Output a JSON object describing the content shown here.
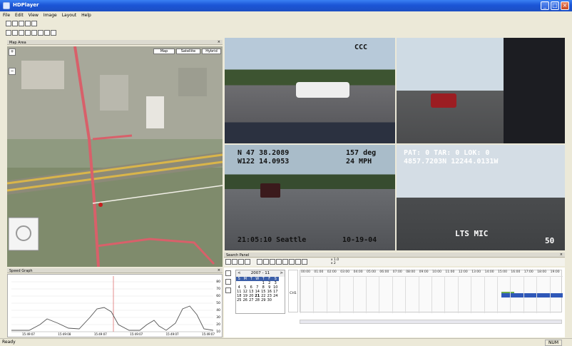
{
  "window": {
    "title": "HDPlayer",
    "min": "_",
    "max": "□",
    "close": "×"
  },
  "menu": [
    "File",
    "Edit",
    "View",
    "Image",
    "Layout",
    "Help"
  ],
  "map_panel": {
    "title": "Map Area",
    "close": "×",
    "map_types": [
      "Map",
      "Satellite",
      "Hybrid"
    ],
    "nav_up": "+",
    "nav_down": "−"
  },
  "speed_panel": {
    "title": "Speed Graph",
    "close": "×",
    "y_labels": [
      "80",
      "70",
      "60",
      "50",
      "40",
      "30",
      "20",
      "10"
    ],
    "x_labels": [
      "15:49:07",
      "15:49:08",
      "15:49:07",
      "15:49:07",
      "15:49:07",
      "15:49:07"
    ]
  },
  "search_panel": {
    "title": "Search Panel",
    "close": "×",
    "month": "2007 - 11",
    "prev": "<",
    "next": ">",
    "weekdays": [
      "S",
      "M",
      "T",
      "W",
      "T",
      "F",
      "S"
    ],
    "days": [
      [
        "",
        "",
        "",
        "",
        "1",
        "2",
        "3"
      ],
      [
        "4",
        "5",
        "6",
        "7",
        "8",
        "9",
        "10"
      ],
      [
        "11",
        "12",
        "13",
        "14",
        "15",
        "16",
        "17"
      ],
      [
        "18",
        "19",
        "20",
        "21",
        "22",
        "23",
        "24"
      ],
      [
        "25",
        "26",
        "27",
        "28",
        "29",
        "30",
        ""
      ]
    ],
    "hours": [
      "00:00",
      "01:00",
      "02:00",
      "03:00",
      "04:00",
      "05:00",
      "06:00",
      "07:00",
      "08:00",
      "09:00",
      "10:00",
      "11:00",
      "12:00",
      "13:00",
      "14:00",
      "15:00",
      "16:00",
      "17:00",
      "18:00",
      "19:00"
    ],
    "ch_label": "CH1",
    "speed_1": "x 1.0",
    "speed_2": "x 2"
  },
  "cam1": {
    "label": "CCC"
  },
  "cam3": {
    "line1": "N 47 38.2089",
    "line2": "W122 14.0953",
    "right1": "157 deg",
    "right2": "24 MPH",
    "bottom": "21:05:10 Seattle",
    "date": "10-19-04"
  },
  "cam4": {
    "line1": "PAT: 0 TAR: 0 LOK: 0",
    "line2": "4857.7203N 12244.0131W",
    "bottom": "LTS MIC",
    "corner": "50"
  },
  "status": {
    "left": "Ready",
    "right": "NUM"
  }
}
